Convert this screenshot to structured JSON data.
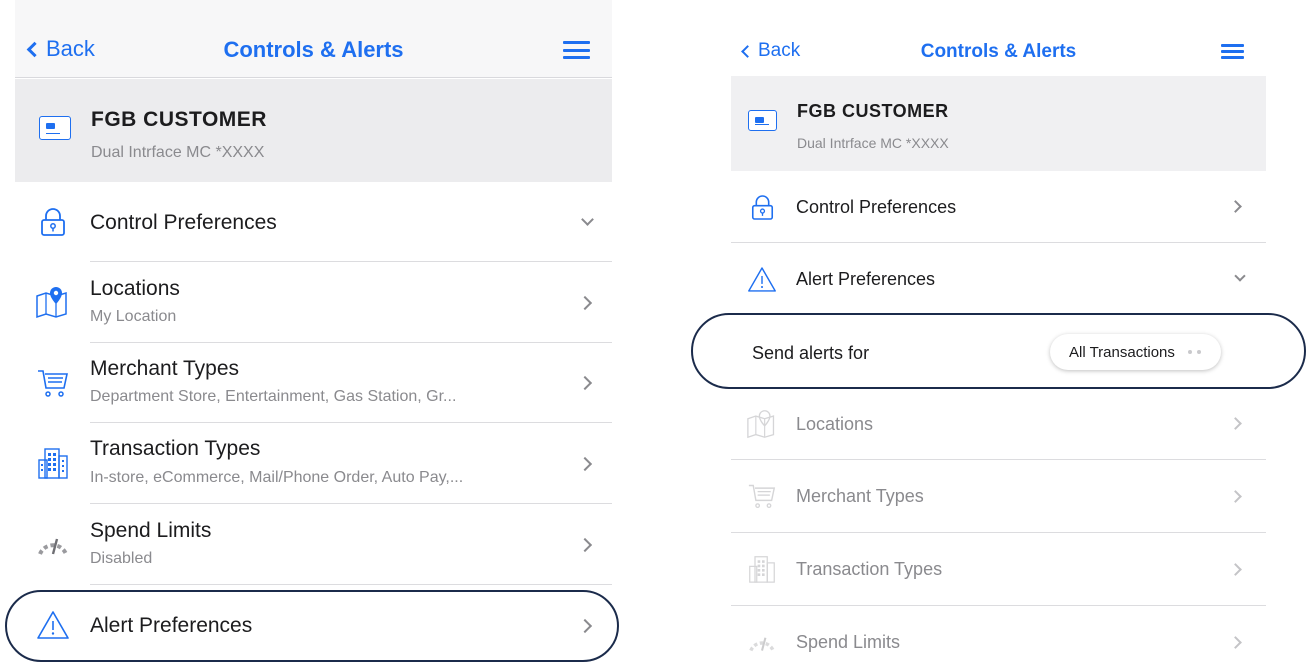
{
  "colors": {
    "accent": "#1e6ff0",
    "highlight_outline": "#1b2b4b",
    "secondary_text": "#8a8a8e"
  },
  "left": {
    "nav": {
      "back_label": "Back",
      "title": "Controls & Alerts"
    },
    "account": {
      "name": "FGB CUSTOMER",
      "card": "Dual Intrface MC *XXXX"
    },
    "rows": [
      {
        "title": "Control Preferences",
        "icon": "lock-icon",
        "accessory": "chevron-down"
      },
      {
        "title": "Locations",
        "subtitle": "My Location",
        "icon": "map-pin-icon",
        "accessory": "chevron-right"
      },
      {
        "title": "Merchant Types",
        "subtitle": "Department Store, Entertainment, Gas Station, Gr...",
        "icon": "shopping-cart-icon",
        "accessory": "chevron-right"
      },
      {
        "title": "Transaction Types",
        "subtitle": "In-store, eCommerce, Mail/Phone Order, Auto Pay,...",
        "icon": "building-icon",
        "accessory": "chevron-right"
      },
      {
        "title": "Spend Limits",
        "subtitle": "Disabled",
        "icon": "speedometer-icon",
        "accessory": "chevron-right"
      },
      {
        "title": "Alert Preferences",
        "icon": "warning-icon",
        "accessory": "chevron-right",
        "highlighted": true
      }
    ]
  },
  "right": {
    "nav": {
      "back_label": "Back",
      "title": "Controls & Alerts"
    },
    "account": {
      "name": "FGB CUSTOMER",
      "card": "Dual Intrface MC *XXXX"
    },
    "rows": [
      {
        "title": "Control Preferences",
        "icon": "lock-icon",
        "accessory": "chevron-right"
      },
      {
        "title": "Alert Preferences",
        "icon": "warning-icon",
        "accessory": "chevron-down"
      },
      {
        "title": "Locations",
        "icon": "map-pin-icon",
        "accessory": "chevron-right",
        "disabled": true
      },
      {
        "title": "Merchant Types",
        "icon": "shopping-cart-icon",
        "accessory": "chevron-right",
        "disabled": true
      },
      {
        "title": "Transaction Types",
        "icon": "building-icon",
        "accessory": "chevron-right",
        "disabled": true
      },
      {
        "title": "Spend Limits",
        "icon": "speedometer-icon",
        "accessory": "chevron-right",
        "disabled": true
      }
    ],
    "alerts_for": {
      "label": "Send alerts for",
      "value": "All Transactions",
      "highlighted": true
    }
  }
}
